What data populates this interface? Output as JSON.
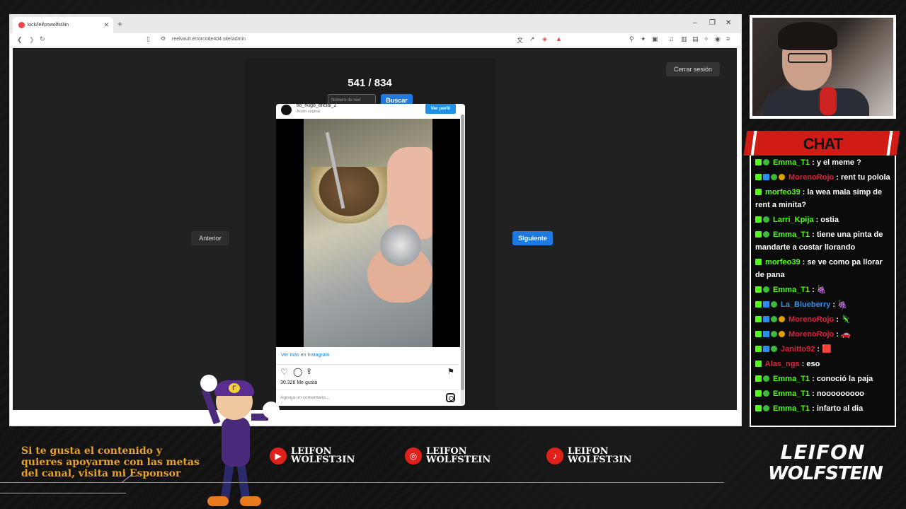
{
  "browser": {
    "tab_title": "kick/leifonwolfst3in",
    "tab_close": "✕",
    "new_tab": "+",
    "url": "reelvault.errorcode404.site/admin",
    "minimize": "–",
    "restore": "❐",
    "close": "✕"
  },
  "app": {
    "counter": "541 / 834",
    "reel_input_placeholder": "Número de reel",
    "search_label": "Buscar",
    "logout_label": "Cerrar sesión",
    "prev_label": "Anterior",
    "next_label": "Siguiente"
  },
  "instagram": {
    "username": "tio_hugo_oficial_2",
    "audio": "Audio original",
    "profile_button": "Ver perfil",
    "view_link": "Ver más en Instagram",
    "likes": "30.326 Me gusta",
    "comment_placeholder": "Agrega un comentario..."
  },
  "chat": {
    "title": "CHAT",
    "messages": [
      {
        "user": "Emma_T1",
        "color": "#53fc18",
        "badges": [
          "k",
          "g"
        ],
        "text": ": y el meme ?"
      },
      {
        "user": "MorenoRojo",
        "color": "#e0203a",
        "badges": [
          "k",
          "b",
          "g",
          "o"
        ],
        "text": ": rent tu polola"
      },
      {
        "user": "morfeo39",
        "color": "#53fc18",
        "badges": [
          "k"
        ],
        "text": ": la wea mala simp de rent a minita?"
      },
      {
        "user": "Larri_Kpija",
        "color": "#53fc18",
        "badges": [
          "k",
          "g"
        ],
        "text": ": ostia"
      },
      {
        "user": "Emma_T1",
        "color": "#53fc18",
        "badges": [
          "k",
          "g"
        ],
        "text": ": tiene una pinta de mandarte a costar llorando"
      },
      {
        "user": "morfeo39",
        "color": "#53fc18",
        "badges": [
          "k"
        ],
        "text": ": se ve como pa llorar de pana"
      },
      {
        "user": "Emma_T1",
        "color": "#53fc18",
        "badges": [
          "k",
          "g"
        ],
        "text": ": 🍇"
      },
      {
        "user": "La_Blueberry",
        "color": "#3a8ee6",
        "badges": [
          "k",
          "b",
          "g"
        ],
        "text": ": 🍇"
      },
      {
        "user": "MorenoRojo",
        "color": "#e0203a",
        "badges": [
          "k",
          "b",
          "g",
          "o"
        ],
        "text": ": 🦎"
      },
      {
        "user": "MorenoRojo",
        "color": "#e0203a",
        "badges": [
          "k",
          "b",
          "g",
          "o"
        ],
        "text": ": 🚗"
      },
      {
        "user": "Janitto92",
        "color": "#e0203a",
        "badges": [
          "k",
          "b",
          "g"
        ],
        "text": ": 🟥"
      },
      {
        "user": "Alas_ngs",
        "color": "#e0203a",
        "badges": [
          "k"
        ],
        "text": ": eso"
      },
      {
        "user": "Emma_T1",
        "color": "#53fc18",
        "badges": [
          "k",
          "g"
        ],
        "text": ": conoció la paja"
      },
      {
        "user": "Emma_T1",
        "color": "#53fc18",
        "badges": [
          "k",
          "g"
        ],
        "text": ": nooooooooo"
      },
      {
        "user": "Emma_T1",
        "color": "#53fc18",
        "badges": [
          "k",
          "g"
        ],
        "text": ": infarto al dia"
      }
    ]
  },
  "footer": {
    "sponsor_text": "Si te gusta el contenido y quieres apoyarme con las metas del canal, visita mi Esponsor",
    "youtube_l1": "LEIFON",
    "youtube_l2": "WOLFST3IN",
    "instagram_l1": "LEIFON",
    "instagram_l2": "WOLFSTEIN",
    "tiktok_l1": "LEIFON",
    "tiktok_l2": "WOLFST3IN",
    "logo_top": "LEIFON",
    "logo_bottom": "WOLFSTEIN"
  },
  "icons": {
    "youtube": "youtube-icon",
    "instagram": "instagram-icon",
    "tiktok": "tiktok-icon"
  },
  "colors": {
    "accent_blue": "#1e7ae0",
    "chat_red": "#d01b17",
    "kick_green": "#53fc18",
    "footer_gold": "#e8a22a"
  }
}
